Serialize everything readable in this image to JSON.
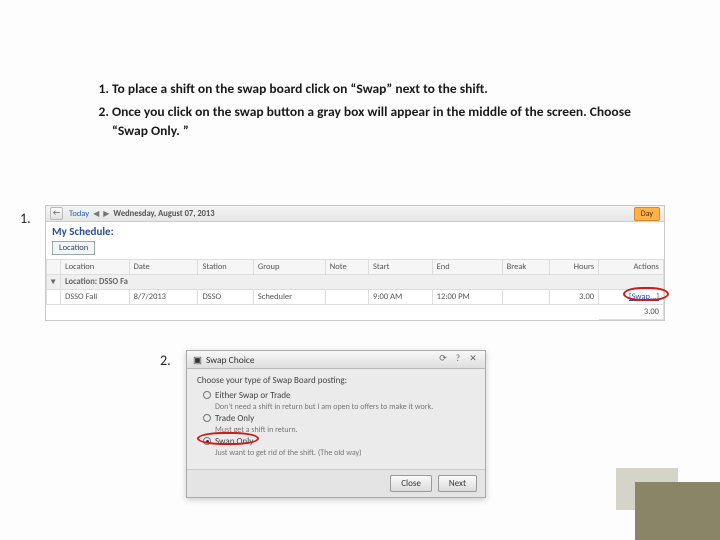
{
  "instructions": {
    "item1": "To place a shift on the swap board click on “Swap” next to the shift.",
    "item2": "Once you click on the swap button a gray box will appear in the middle of the screen.  Choose “Swap Only. ”"
  },
  "labels": {
    "one": "1.",
    "two": "2."
  },
  "schedule": {
    "today": "Today",
    "nav_prev": "◀",
    "nav_next": "▶",
    "date": "Wednesday, August 07, 2013",
    "day_btn": "Day",
    "title": "My Schedule:",
    "location_btn": "Location",
    "headers": {
      "location": "Location",
      "date": "Date",
      "station": "Station",
      "group": "Group",
      "note": "Note",
      "start": "Start",
      "end": "End",
      "break": "Break",
      "hours": "Hours",
      "actions": "Actions"
    },
    "location_row": "Location: DSSO Fa",
    "row": {
      "location": "DSSO Fall",
      "date": "8/7/2013",
      "station": "DSSO",
      "group": "Scheduler",
      "note": "",
      "start": "9:00 AM",
      "end": "12:00 PM",
      "break": "",
      "hours": "3.00",
      "actions": "[Swap...]"
    },
    "total": "3.00"
  },
  "dialog": {
    "title_icon": "▣",
    "title": "Swap Choice",
    "refresh": "⟳",
    "help": "?",
    "close": "✕",
    "prompt": "Choose your type of Swap Board posting:",
    "opt1_label": "Either Swap or Trade",
    "opt1_sub": "Don't need a shift in return but I am open to offers to make it work.",
    "opt2_label": "Trade Only",
    "opt2_sub": "Must get a shift in return.",
    "opt3_label": "Swap Only",
    "opt3_sub": "Just want to get rid of the shift. (The old way)",
    "btn_close": "Close",
    "btn_next": "Next"
  }
}
